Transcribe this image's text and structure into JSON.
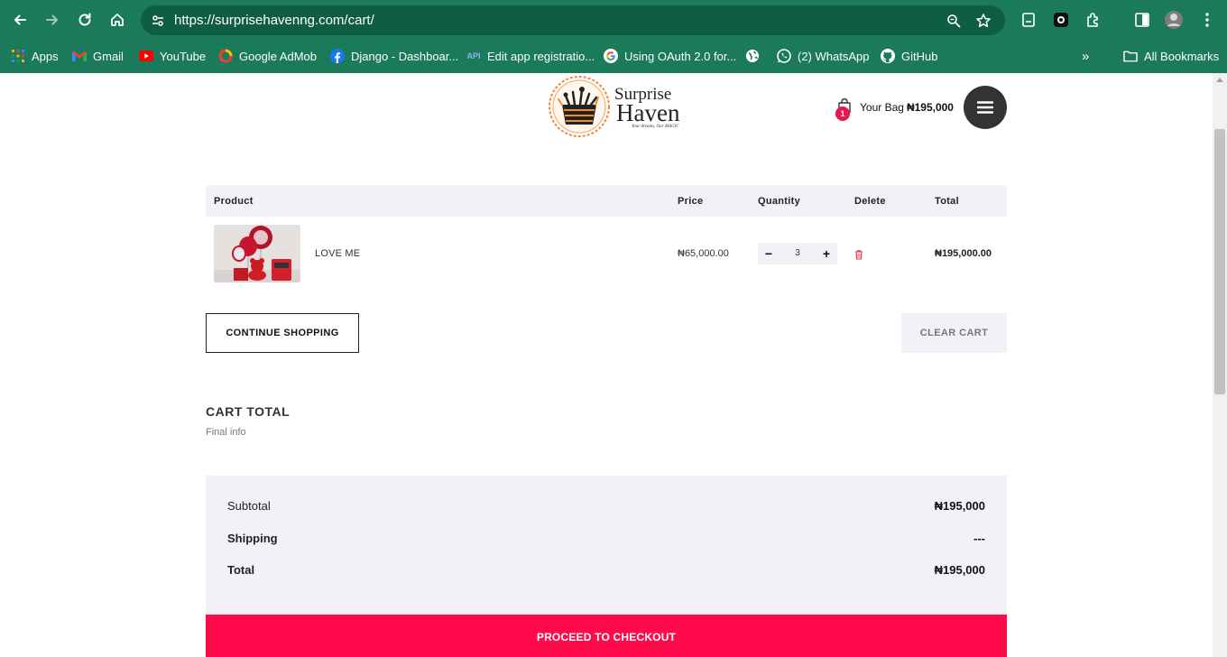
{
  "browser": {
    "url": "https://surprisehavenng.com/cart/",
    "bookmarks": [
      {
        "label": "Apps",
        "icon": "apps-grid-icon"
      },
      {
        "label": "Gmail",
        "icon": "gmail-icon"
      },
      {
        "label": "YouTube",
        "icon": "youtube-icon"
      },
      {
        "label": "Google AdMob",
        "icon": "admob-icon"
      },
      {
        "label": "Django - Dashboar...",
        "icon": "facebook-icon"
      },
      {
        "label": "Edit app registratio...",
        "icon": "api-icon"
      },
      {
        "label": "Using OAuth 2.0 for...",
        "icon": "google-icon"
      },
      {
        "label": "",
        "icon": "globe-icon"
      },
      {
        "label": "(2) WhatsApp",
        "icon": "whatsapp-icon"
      },
      {
        "label": "GitHub",
        "icon": "github-icon"
      }
    ],
    "overflow_label": "»",
    "all_bookmarks": "All Bookmarks"
  },
  "header": {
    "logo_title": "Surprise Haven",
    "logo_line1": "Surprise",
    "logo_line2": "Haven",
    "logo_tagline": "Your dreams, Our MAGIC",
    "bag_count": "1",
    "bag_label": "Your Bag",
    "bag_amount": "₦195,000"
  },
  "cart": {
    "columns": {
      "product": "Product",
      "price": "Price",
      "quantity": "Quantity",
      "delete": "Delete",
      "total": "Total"
    },
    "items": [
      {
        "name": "LOVE ME",
        "price": "₦65,000.00",
        "quantity": "3",
        "total": "₦195,000.00"
      }
    ],
    "qty_minus": "−",
    "qty_plus": "+",
    "continue_label": "CONTINUE SHOPPING",
    "clear_label": "CLEAR CART"
  },
  "cart_total": {
    "title": "CART TOTAL",
    "subtitle": "Final info",
    "subtotal_label": "Subtotal",
    "subtotal_value": "₦195,000",
    "shipping_label": "Shipping",
    "shipping_value": "---",
    "total_label": "Total",
    "total_value": "₦195,000",
    "checkout_label": "PROCEED TO CHECKOUT"
  },
  "colors": {
    "chrome": "#1b7a5a",
    "accent": "#ff0a4b",
    "panel": "#f3f1f7"
  }
}
